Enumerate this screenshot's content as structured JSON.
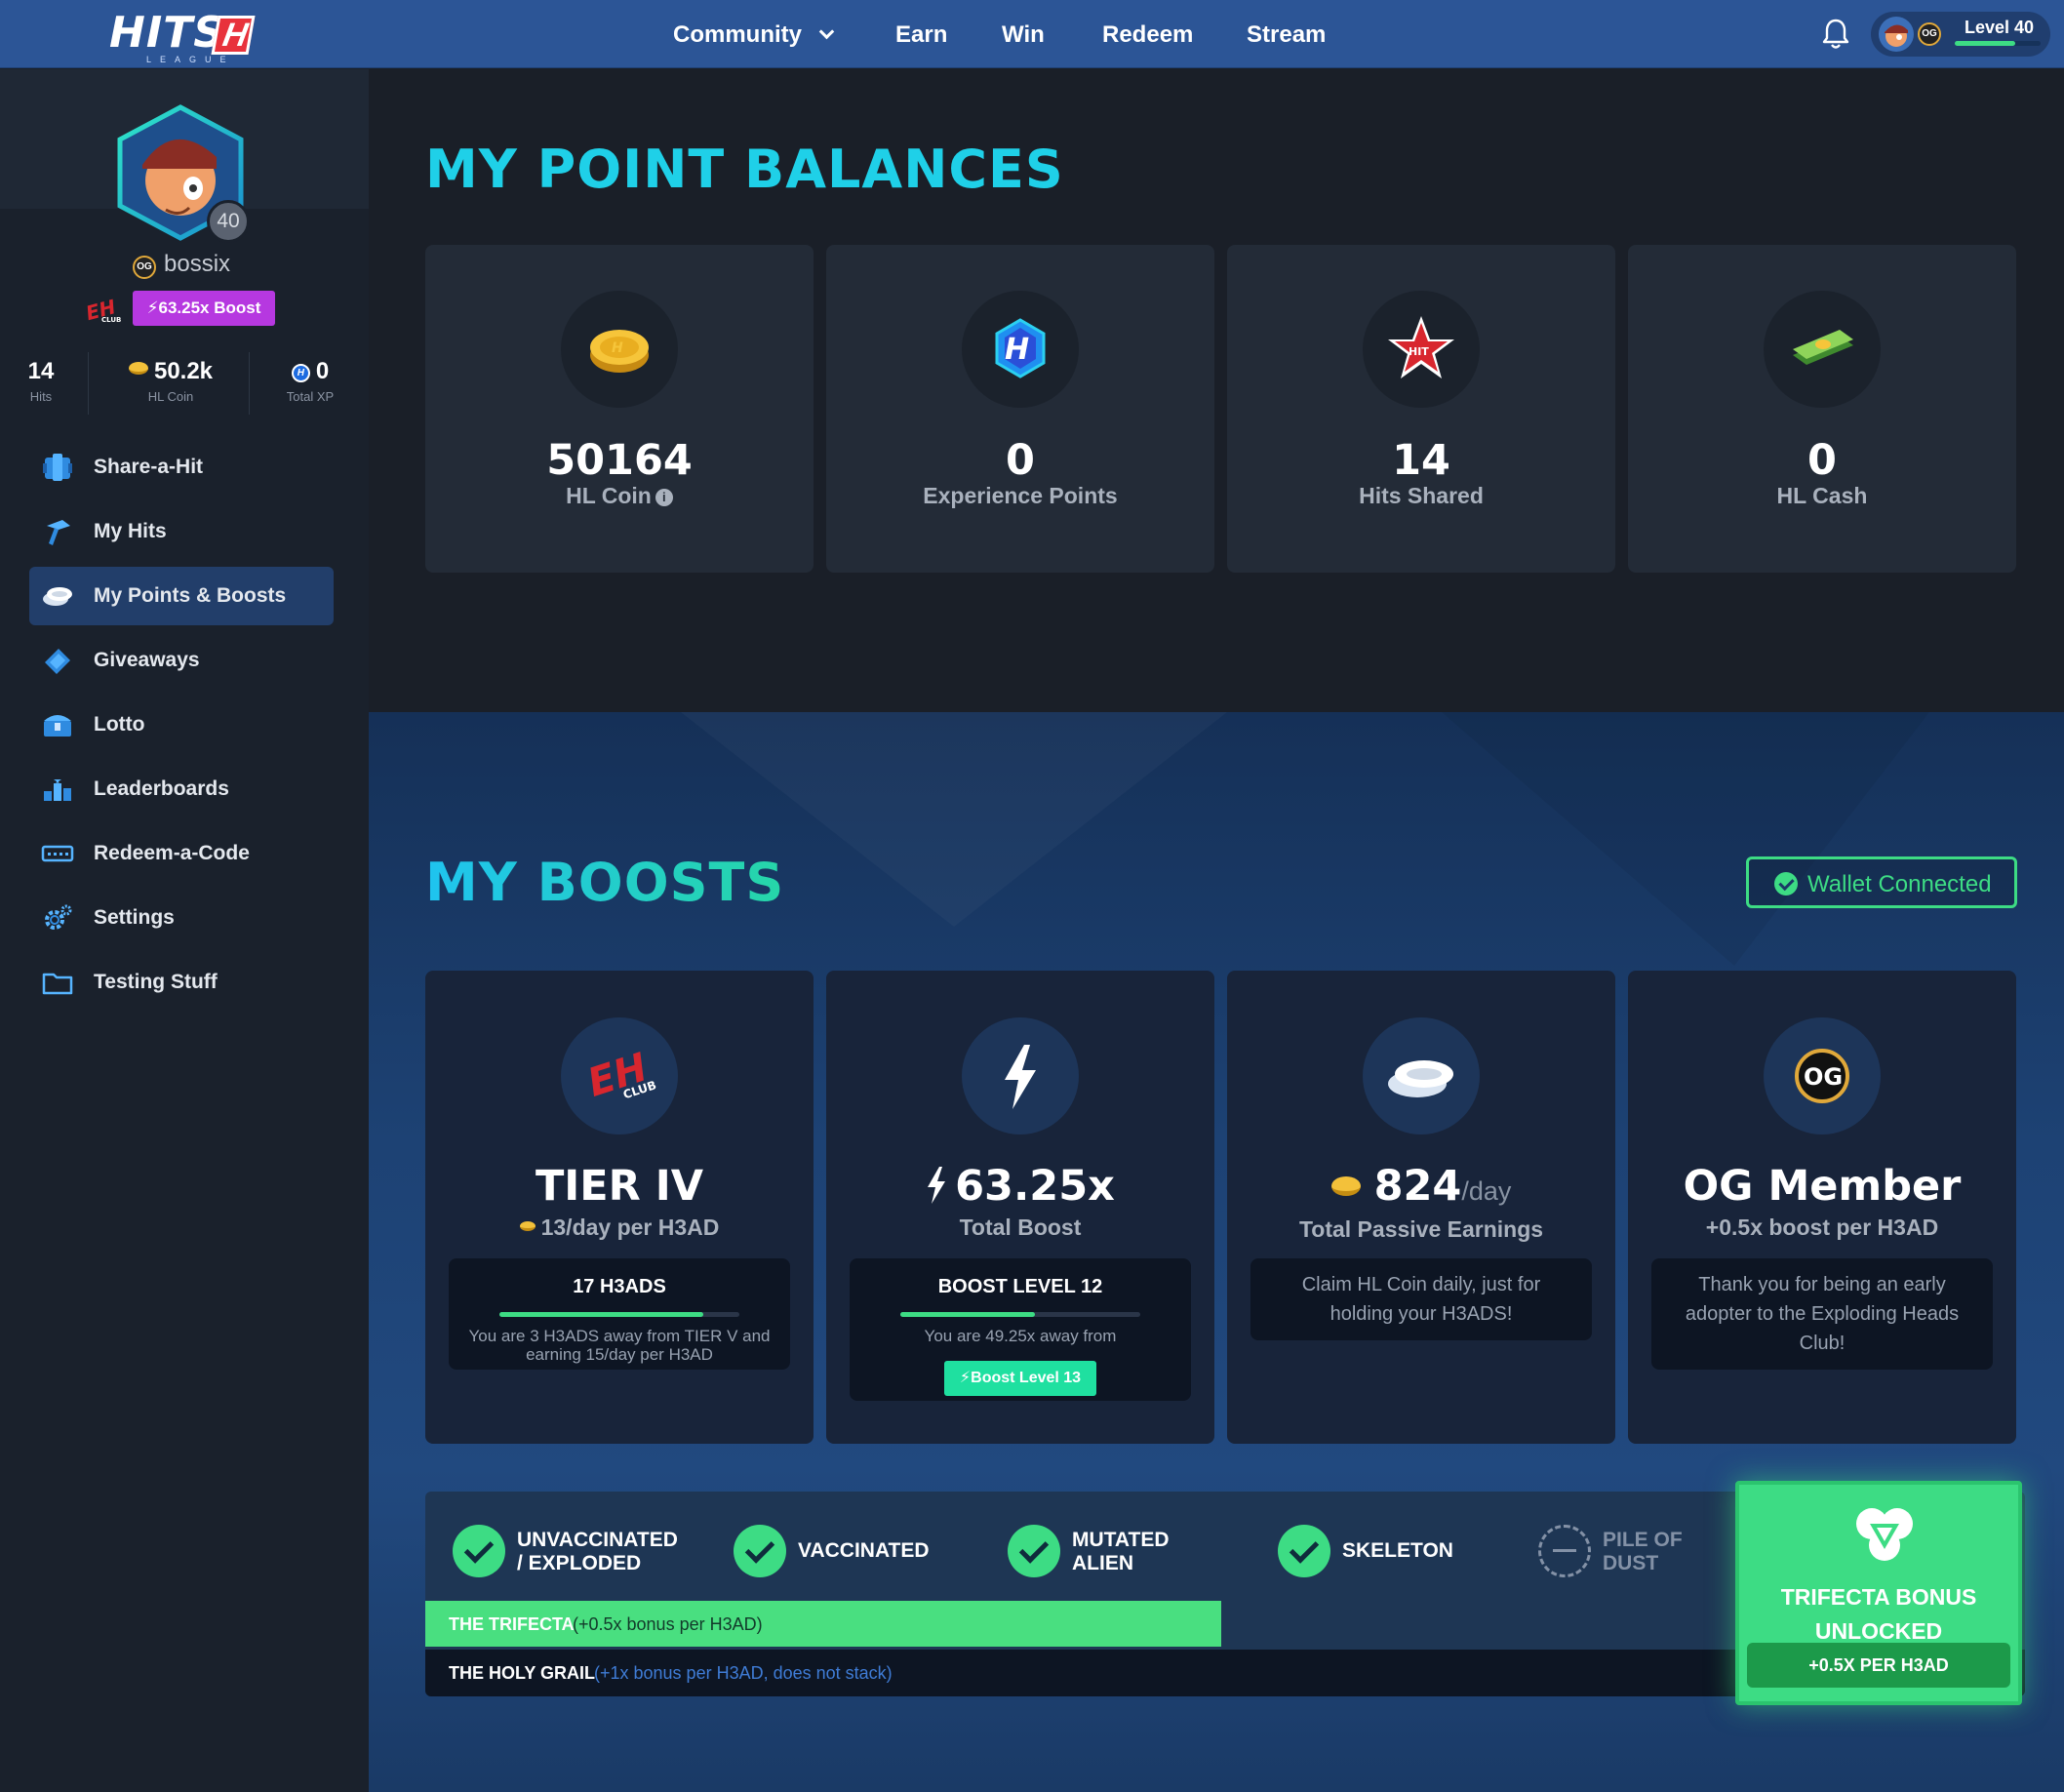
{
  "nav": {
    "logo_text": "HITS",
    "logo_box_letter": "H",
    "logo_sub": "LEAGUE",
    "items": [
      "Community",
      "Earn",
      "Win",
      "Redeem",
      "Stream"
    ],
    "level_label": "Level 40",
    "og_badge": "OG",
    "level_progress": 0.7
  },
  "profile": {
    "level": "40",
    "og_badge": "OG",
    "username": "bossix",
    "boost_tag": "63.25x Boost",
    "stats": [
      {
        "value": "14",
        "label": "Hits"
      },
      {
        "value": "50.2k",
        "label": "HL Coin"
      },
      {
        "value": "0",
        "label": "Total XP"
      }
    ]
  },
  "sidebar": {
    "items": [
      {
        "label": "Share-a-Hit",
        "icon": "share-hit-icon"
      },
      {
        "label": "My Hits",
        "icon": "my-hits-icon"
      },
      {
        "label": "My Points & Boosts",
        "icon": "coins-icon",
        "active": true
      },
      {
        "label": "Giveaways",
        "icon": "ticket-icon"
      },
      {
        "label": "Lotto",
        "icon": "chest-icon"
      },
      {
        "label": "Leaderboards",
        "icon": "leaderboard-icon"
      },
      {
        "label": "Redeem-a-Code",
        "icon": "code-icon"
      },
      {
        "label": "Settings",
        "icon": "gear-icon"
      },
      {
        "label": "Testing Stuff",
        "icon": "folder-icon"
      }
    ]
  },
  "balances": {
    "title": "MY POINT BALANCES",
    "cards": [
      {
        "value": "50164",
        "label": "HL Coin",
        "icon": "hl-coin-icon",
        "info": "i"
      },
      {
        "value": "0",
        "label": "Experience Points",
        "icon": "hl-badge-icon"
      },
      {
        "value": "14",
        "label": "Hits Shared",
        "icon": "hit-star-icon"
      },
      {
        "value": "0",
        "label": "HL Cash",
        "icon": "cash-stack-icon"
      }
    ]
  },
  "boosts": {
    "title": "MY BOOSTS",
    "wallet_label": "Wallet Connected",
    "cards": [
      {
        "title": "TIER IV",
        "subtitle": "13/day per H3AD",
        "panel_title": "17 H3ADS",
        "progress": 0.85,
        "panel_text": "You are 3 H3ADS away from TIER V and earning 15/day per H3AD"
      },
      {
        "title": "63.25x",
        "subtitle": "Total Boost",
        "panel_title": "BOOST LEVEL 12",
        "progress": 0.56,
        "panel_text": "You are 49.25x away from",
        "button": "Boost Level 13"
      },
      {
        "title": "824",
        "title_suffix": "/day",
        "subtitle": "Total Passive Earnings",
        "panel_text": "Claim HL Coin daily, just for holding your H3ADS!"
      },
      {
        "title": "OG Member",
        "subtitle": "+0.5x boost per H3AD",
        "panel_text": "Thank you for being an early adopter to the Exploding Heads Club!"
      }
    ]
  },
  "trifecta": {
    "items": [
      {
        "label_line1": "UNVACCINATED",
        "label_line2": "/ EXPLODED",
        "done": true
      },
      {
        "label_line1": "VACCINATED",
        "label_line2": "",
        "done": true
      },
      {
        "label_line1": "MUTATED",
        "label_line2": "ALIEN",
        "done": true
      },
      {
        "label_line1": "SKELETON",
        "label_line2": "",
        "done": true
      },
      {
        "label_line1": "PILE OF",
        "label_line2": "DUST",
        "done": false
      }
    ],
    "trifecta_row": {
      "name": "THE TRIFECTA",
      "desc": "(+0.5x bonus per H3AD)"
    },
    "holy_row": {
      "name": "THE HOLY GRAIL",
      "desc": "(+1x bonus per H3AD, does not stack)"
    },
    "bonus_title_1": "TRIFECTA BONUS",
    "bonus_title_2": "UNLOCKED",
    "bonus_pill": "+0.5X PER H3AD"
  },
  "colors": {
    "nav": "#2c5596",
    "accent_cyan": "#1fd0e8",
    "green": "#3ddc84",
    "boost_purple": "#b638e0"
  }
}
